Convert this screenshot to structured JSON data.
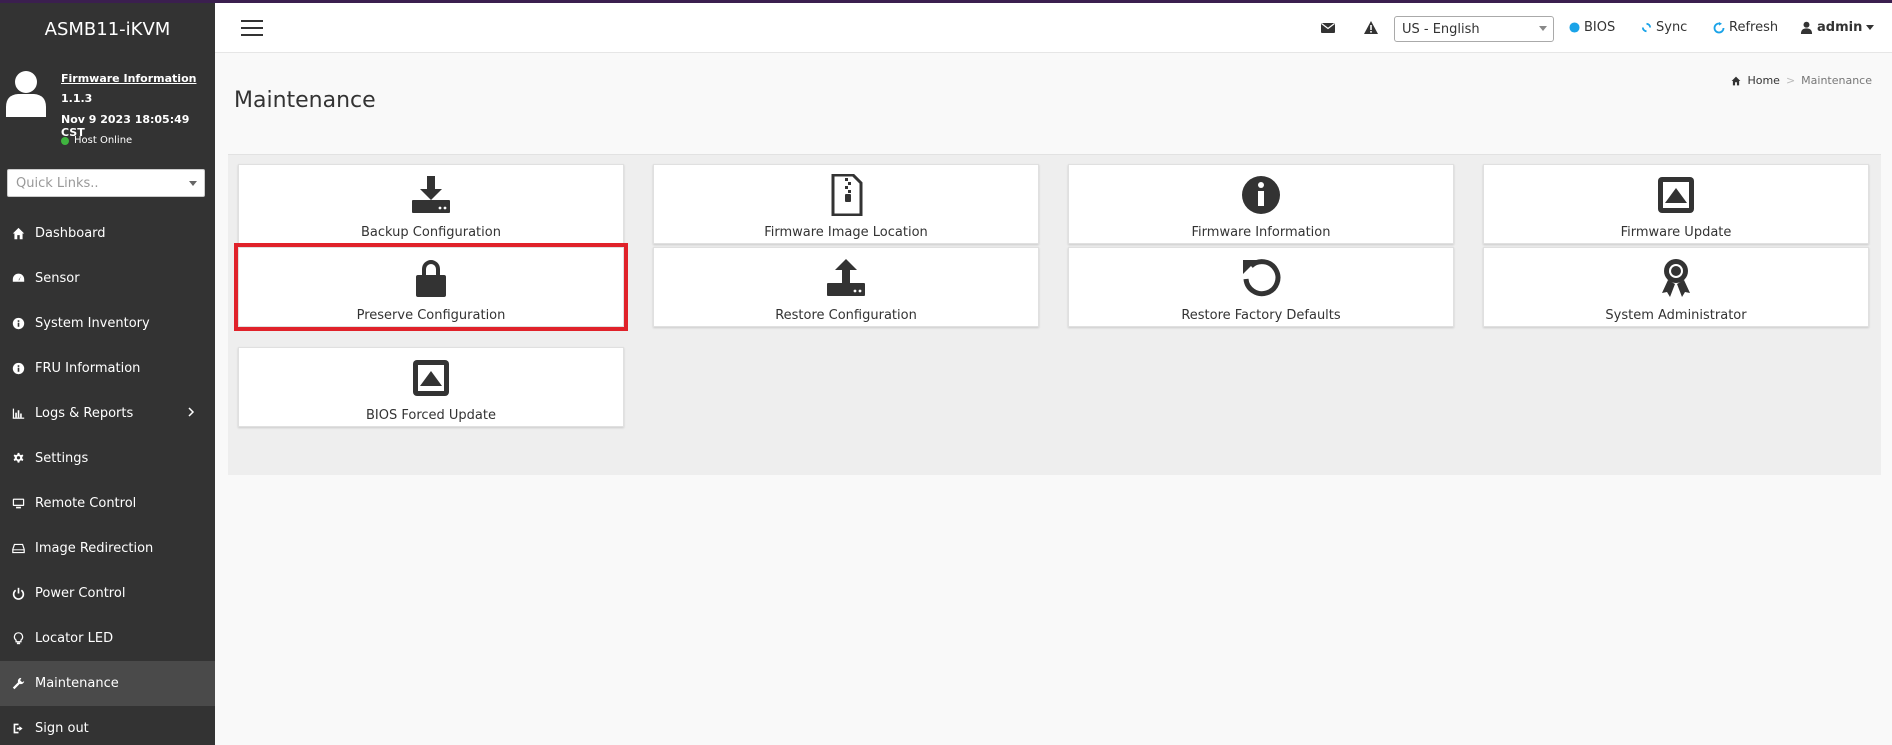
{
  "app": {
    "brand": "ASMB11-iKVM",
    "firmware_link": "Firmware Information",
    "firmware_version": "1.1.3",
    "firmware_date": "Nov 9 2023 18:05:49 CST",
    "host_status": "Host Online",
    "host_status_color": "#3fb43f",
    "accent_color": "#3b1f4f",
    "highlight_color": "#e0222a"
  },
  "sidebar": {
    "quicklinks_placeholder": "Quick Links..",
    "items": [
      {
        "label": "Dashboard",
        "icon": "home-icon"
      },
      {
        "label": "Sensor",
        "icon": "gauge-icon"
      },
      {
        "label": "System Inventory",
        "icon": "info-circle-icon"
      },
      {
        "label": "FRU Information",
        "icon": "info-circle-icon"
      },
      {
        "label": "Logs & Reports",
        "icon": "bar-chart-icon"
      },
      {
        "label": "Settings",
        "icon": "gear-icon"
      },
      {
        "label": "Remote Control",
        "icon": "monitor-icon"
      },
      {
        "label": "Image Redirection",
        "icon": "drive-icon"
      },
      {
        "label": "Power Control",
        "icon": "power-icon"
      },
      {
        "label": "Locator LED",
        "icon": "lightbulb-icon"
      },
      {
        "label": "Maintenance",
        "icon": "wrench-icon",
        "active": true
      },
      {
        "label": "Sign out",
        "icon": "sign-out-icon"
      }
    ]
  },
  "header": {
    "language": "US - English",
    "bios_label": "BIOS",
    "sync_label": "Sync",
    "refresh_label": "Refresh",
    "user_label": "admin"
  },
  "main": {
    "title": "Maintenance",
    "breadcrumb": {
      "home": "Home",
      "current": "Maintenance"
    },
    "tiles": [
      {
        "label": "Backup Configuration",
        "icon": "download-icon"
      },
      {
        "label": "Firmware Image Location",
        "icon": "file-zip-icon"
      },
      {
        "label": "Firmware Information",
        "icon": "info-circle-icon"
      },
      {
        "label": "Firmware Update",
        "icon": "eject-square-icon"
      },
      {
        "label": "Preserve Configuration",
        "icon": "lock-icon",
        "highlighted": true
      },
      {
        "label": "Restore Configuration",
        "icon": "upload-icon"
      },
      {
        "label": "Restore Factory Defaults",
        "icon": "undo-icon"
      },
      {
        "label": "System Administrator",
        "icon": "award-icon"
      },
      {
        "label": "BIOS Forced Update",
        "icon": "eject-square-icon"
      }
    ]
  }
}
